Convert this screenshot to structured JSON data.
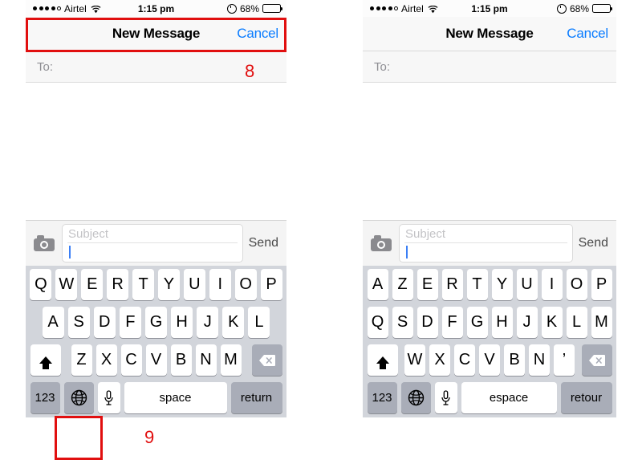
{
  "panels": [
    {
      "id": "left",
      "status": {
        "carrier": "Airtel",
        "time": "1:15 pm",
        "battery": "68%",
        "signal_dots_filled": 4,
        "signal_dots_hollow": 1,
        "wifi_icon": "wifi-icon",
        "alarm_icon": "alarm-clock-icon",
        "battery_icon": "battery-icon"
      },
      "nav": {
        "title": "New Message",
        "cancel": "Cancel"
      },
      "to": {
        "label": "To:"
      },
      "compose": {
        "camera_icon": "camera-icon",
        "subject_placeholder": "Subject",
        "send_label": "Send"
      },
      "keyboard": {
        "layout": "QWERTY",
        "row1": [
          "Q",
          "W",
          "E",
          "R",
          "T",
          "Y",
          "U",
          "I",
          "O",
          "P"
        ],
        "row2": [
          "A",
          "S",
          "D",
          "F",
          "G",
          "H",
          "J",
          "K",
          "L"
        ],
        "row3": [
          "Z",
          "X",
          "C",
          "V",
          "B",
          "N",
          "M"
        ],
        "shift_icon": "shift-arrow-icon",
        "delete_icon": "backspace-icon",
        "numbers_label": "123",
        "globe_icon": "globe-icon",
        "mic_icon": "microphone-icon",
        "space_label": "space",
        "return_label": "return"
      }
    },
    {
      "id": "right",
      "status": {
        "carrier": "Airtel",
        "time": "1:15 pm",
        "battery": "68%",
        "signal_dots_filled": 4,
        "signal_dots_hollow": 1,
        "wifi_icon": "wifi-icon",
        "alarm_icon": "alarm-clock-icon",
        "battery_icon": "battery-icon"
      },
      "nav": {
        "title": "New Message",
        "cancel": "Cancel"
      },
      "to": {
        "label": "To:"
      },
      "compose": {
        "camera_icon": "camera-icon",
        "subject_placeholder": "Subject",
        "send_label": "Send"
      },
      "keyboard": {
        "layout": "AZERTY",
        "row1": [
          "A",
          "Z",
          "E",
          "R",
          "T",
          "Y",
          "U",
          "I",
          "O",
          "P"
        ],
        "row2": [
          "Q",
          "S",
          "D",
          "F",
          "G",
          "H",
          "J",
          "K",
          "L",
          "M"
        ],
        "row3": [
          "W",
          "X",
          "C",
          "V",
          "B",
          "N",
          "’"
        ],
        "shift_icon": "shift-arrow-icon",
        "delete_icon": "backspace-icon",
        "numbers_label": "123",
        "globe_icon": "globe-icon",
        "mic_icon": "microphone-icon",
        "space_label": "espace",
        "return_label": "retour"
      }
    }
  ],
  "annotations": {
    "color": "#e10f0f",
    "step_8": "8",
    "step_9": "9"
  }
}
